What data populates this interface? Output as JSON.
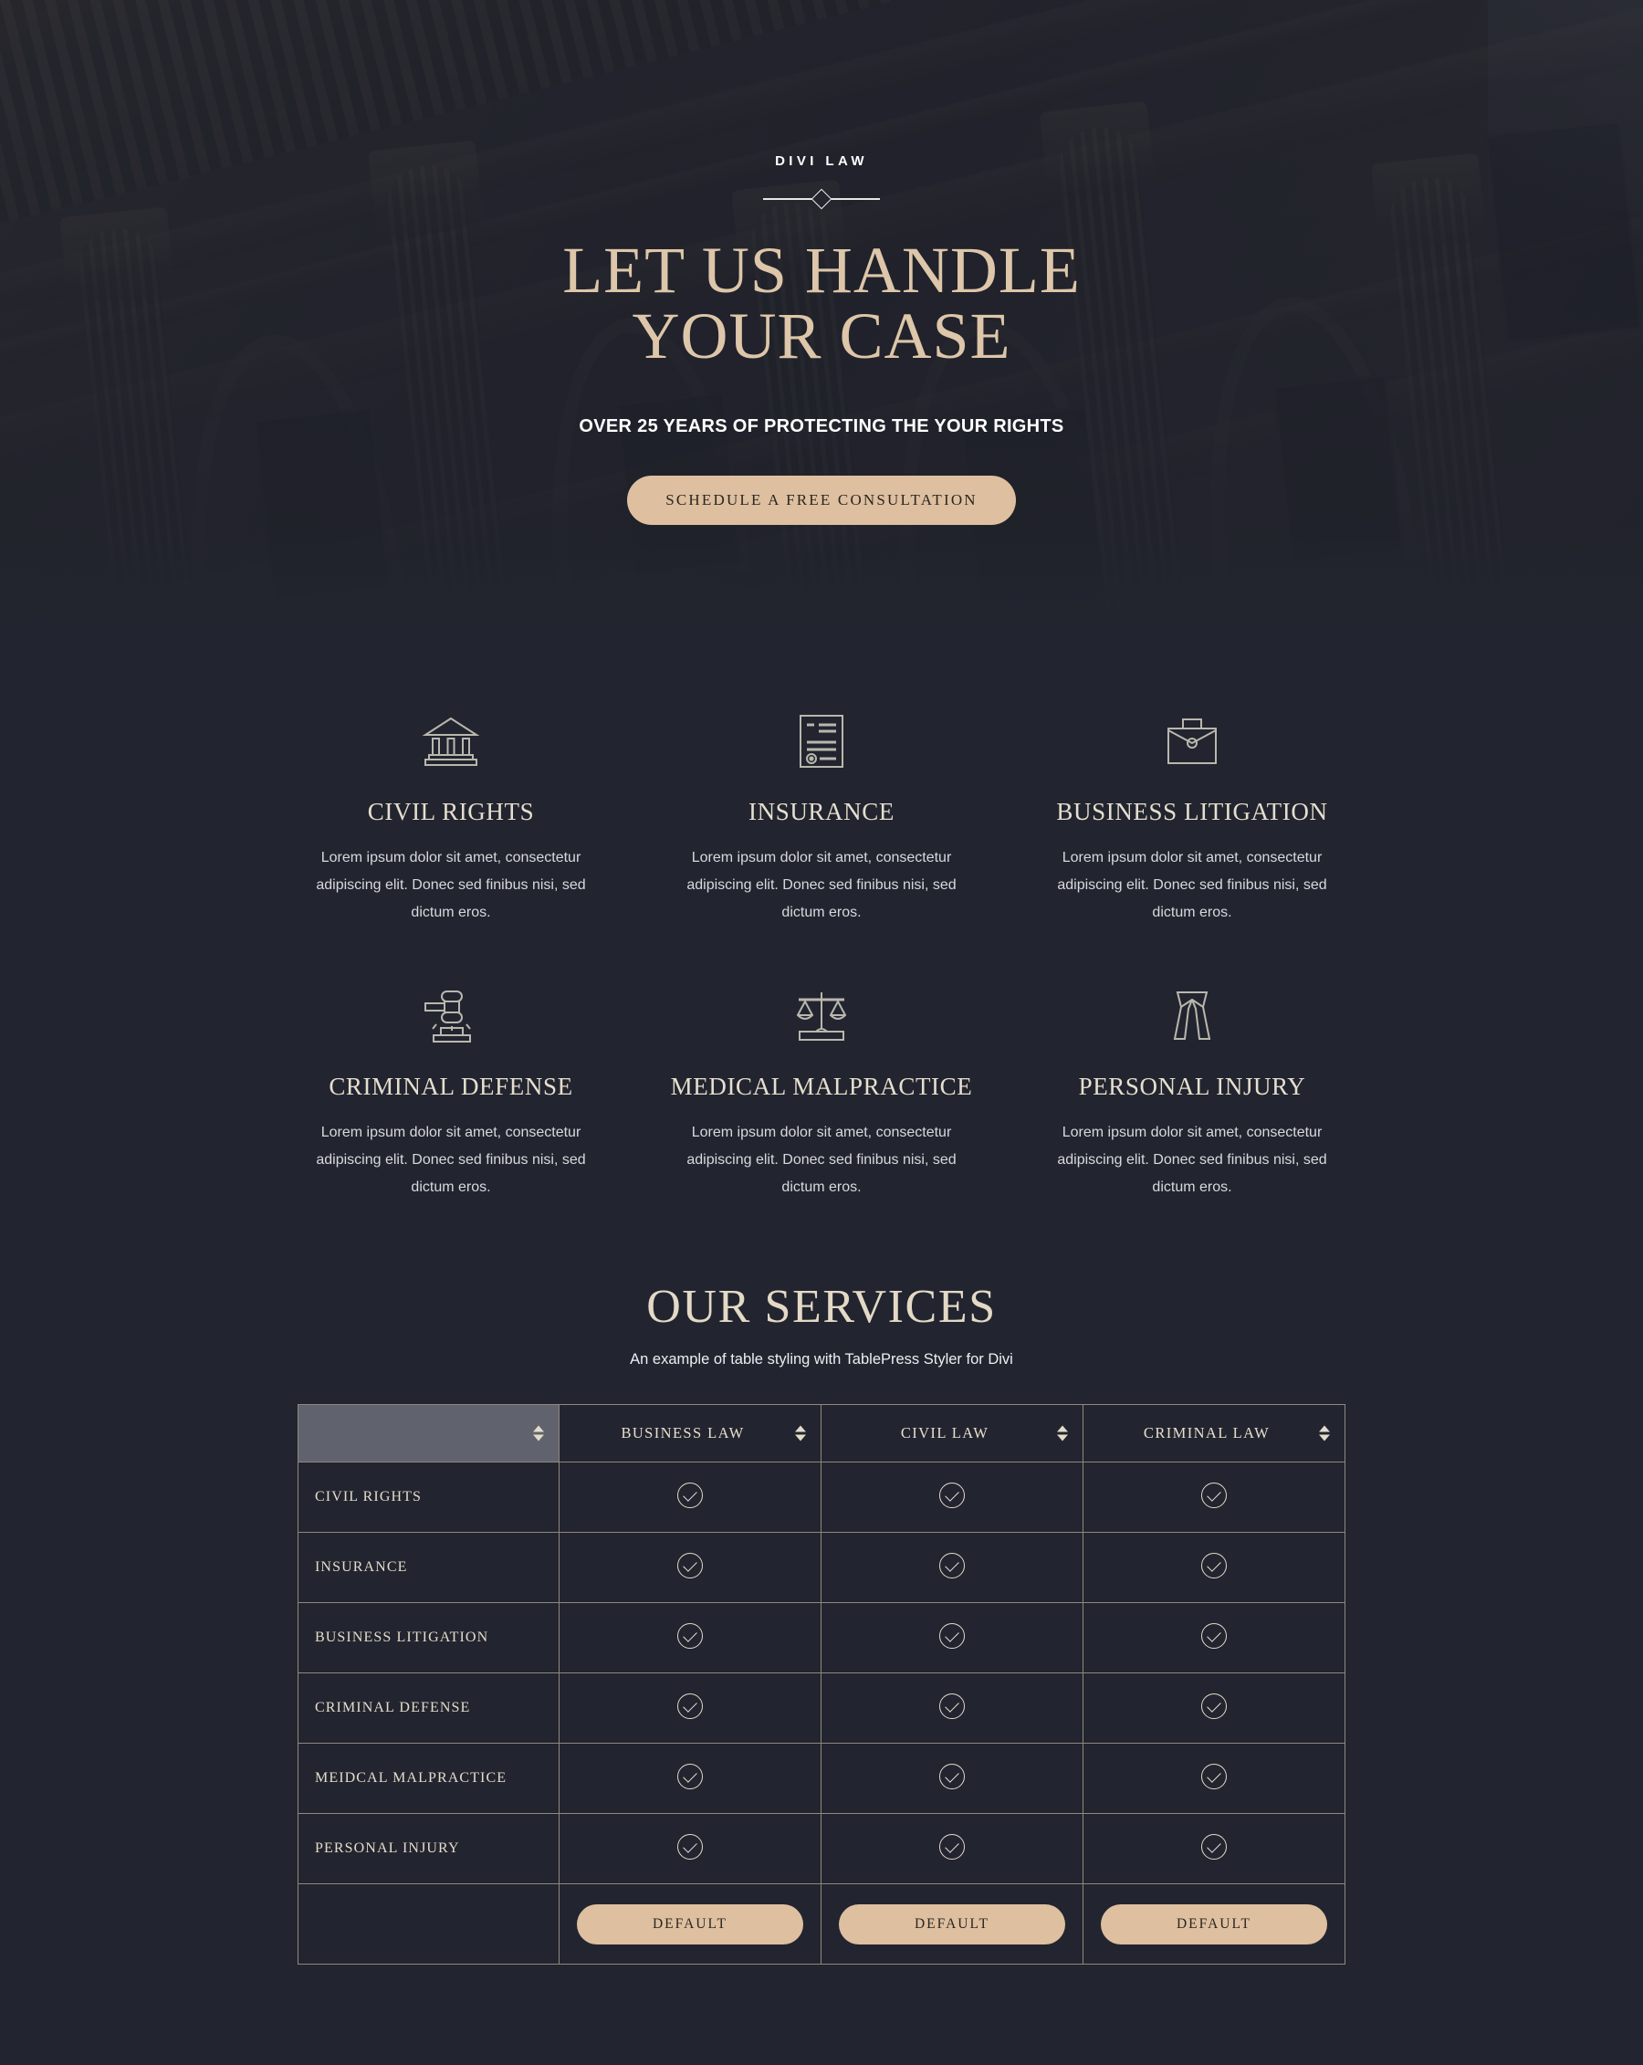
{
  "hero": {
    "eyebrow": "DIVI LAW",
    "title_line1": "LET US HANDLE",
    "title_line2": "YOUR CASE",
    "subtitle": "OVER 25 YEARS OF PROTECTING THE YOUR RIGHTS",
    "cta_label": "SCHEDULE A FREE CONSULTATION",
    "accent_color": "#ddc6a9",
    "button_color": "#debfa0"
  },
  "services": {
    "body_text": "Lorem ipsum dolor sit amet, consectetur adipiscing elit. Donec sed finibus nisi, sed dictum eros.",
    "cards": [
      {
        "icon": "courthouse-icon",
        "title": "CIVIL RIGHTS",
        "text": "Lorem ipsum dolor sit amet, consectetur adipiscing elit. Donec sed finibus nisi, sed dictum eros."
      },
      {
        "icon": "document-icon",
        "title": "INSURANCE",
        "text": "Lorem ipsum dolor sit amet, consectetur adipiscing elit. Donec sed finibus nisi, sed dictum eros."
      },
      {
        "icon": "briefcase-icon",
        "title": "BUSINESS LITIGATION",
        "text": "Lorem ipsum dolor sit amet, consectetur adipiscing elit. Donec sed finibus nisi, sed dictum eros."
      },
      {
        "icon": "gavel-icon",
        "title": "CRIMINAL DEFENSE",
        "text": "Lorem ipsum dolor sit amet, consectetur adipiscing elit. Donec sed finibus nisi, sed dictum eros."
      },
      {
        "icon": "scales-icon",
        "title": "MEDICAL MALPRACTICE",
        "text": "Lorem ipsum dolor sit amet, consectetur adipiscing elit. Donec sed finibus nisi, sed dictum eros."
      },
      {
        "icon": "barrister-bands-icon",
        "title": "PERSONAL INJURY",
        "text": "Lorem ipsum dolor sit amet, consectetur adipiscing elit. Donec sed finibus nisi, sed dictum eros."
      }
    ]
  },
  "table_section": {
    "title": "OUR SERVICES",
    "subtitle": "An example of table styling with TablePress Styler for Divi",
    "sorted_header_color": "#60636e",
    "border_color": "#8e897c",
    "columns": [
      {
        "label": "",
        "sortable": true,
        "sorted": true
      },
      {
        "label": "BUSINESS LAW",
        "sortable": true,
        "sorted": false
      },
      {
        "label": "CIVIL LAW",
        "sortable": true,
        "sorted": false
      },
      {
        "label": "CRIMINAL LAW",
        "sortable": true,
        "sorted": false
      }
    ],
    "rows": [
      {
        "label": "CIVIL RIGHTS",
        "cells": [
          "check",
          "check",
          "check"
        ]
      },
      {
        "label": "INSURANCE",
        "cells": [
          "check",
          "check",
          "check"
        ]
      },
      {
        "label": "BUSINESS LITIGATION",
        "cells": [
          "check",
          "check",
          "check"
        ]
      },
      {
        "label": "CRIMINAL DEFENSE",
        "cells": [
          "check",
          "check",
          "check"
        ]
      },
      {
        "label": "MEIDCAL MALPRACTICE",
        "cells": [
          "check",
          "check",
          "check"
        ]
      },
      {
        "label": "PERSONAL INJURY",
        "cells": [
          "check",
          "check",
          "check"
        ]
      }
    ],
    "footer_row": {
      "label": "",
      "buttons": [
        "DEFAULT",
        "DEFAULT",
        "DEFAULT"
      ]
    }
  }
}
